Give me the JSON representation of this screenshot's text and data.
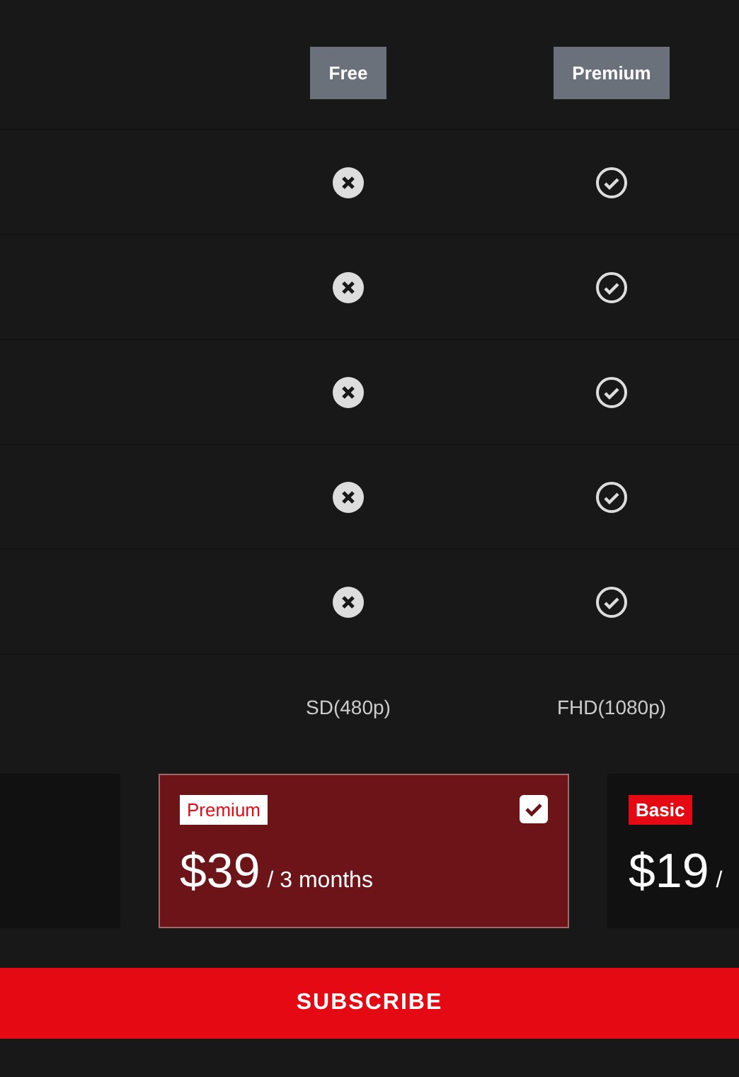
{
  "table": {
    "columns": [
      "Free",
      "Premium"
    ],
    "rows": [
      {
        "kind": "icons",
        "free": false,
        "premium": true
      },
      {
        "kind": "icons",
        "free": false,
        "premium": true
      },
      {
        "kind": "icons",
        "free": false,
        "premium": true
      },
      {
        "kind": "icons",
        "free": false,
        "premium": true
      },
      {
        "kind": "icons",
        "free": false,
        "premium": true
      },
      {
        "kind": "text",
        "free": "SD(480p)",
        "premium": "FHD(1080p)"
      }
    ]
  },
  "plans": [
    {
      "selected": false
    },
    {
      "selected": true,
      "name": "Premium",
      "price": "$39",
      "period": "/ 3 months"
    },
    {
      "selected": false,
      "name": "Basic",
      "price": "$19",
      "period": "/"
    }
  ],
  "subscribe": "SUBSCRIBE"
}
